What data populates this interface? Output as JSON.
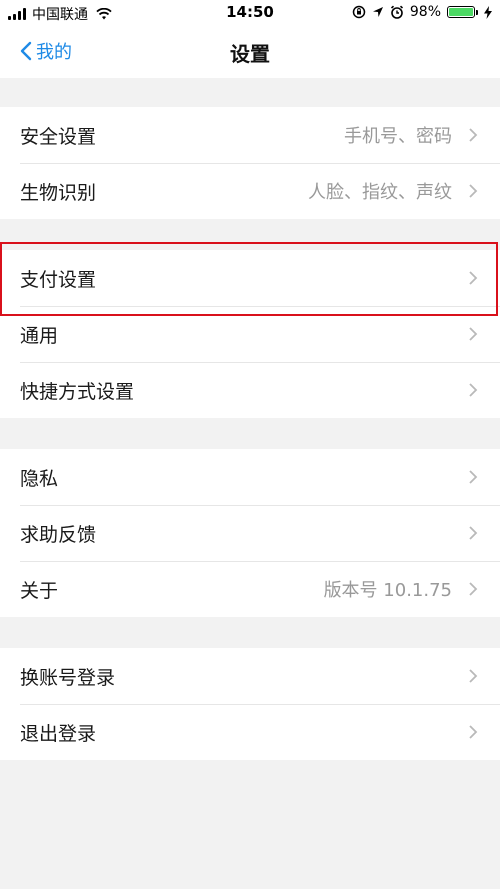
{
  "status_bar": {
    "carrier": "中国联通",
    "time": "14:50",
    "battery": "98%",
    "battery_level": 0.98
  },
  "nav": {
    "back_label": "我的",
    "title": "设置"
  },
  "groups": [
    {
      "items": [
        {
          "label": "安全设置",
          "detail": "手机号、密码"
        },
        {
          "label": "生物识别",
          "detail": "人脸、指纹、声纹"
        }
      ]
    },
    {
      "items": [
        {
          "label": "支付设置",
          "detail": ""
        },
        {
          "label": "通用",
          "detail": ""
        },
        {
          "label": "快捷方式设置",
          "detail": ""
        }
      ]
    },
    {
      "items": [
        {
          "label": "隐私",
          "detail": ""
        },
        {
          "label": "求助反馈",
          "detail": ""
        },
        {
          "label": "关于",
          "detail": "版本号 10.1.75"
        }
      ]
    },
    {
      "items": [
        {
          "label": "换账号登录",
          "detail": ""
        },
        {
          "label": "退出登录",
          "detail": ""
        }
      ]
    }
  ],
  "colors": {
    "accent": "#1e8ae6",
    "highlight_border": "#d9101b",
    "battery": "#4cd964"
  }
}
